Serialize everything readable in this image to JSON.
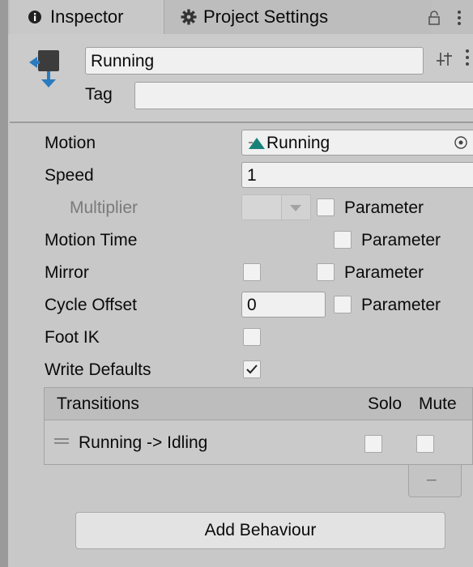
{
  "tabs": [
    {
      "label": "Inspector",
      "icon": "info-icon",
      "active": true
    },
    {
      "label": "Project Settings",
      "icon": "gear-icon",
      "active": false
    }
  ],
  "header": {
    "state_name": "Running",
    "tag_label": "Tag",
    "tag_value": ""
  },
  "properties": {
    "motion_label": "Motion",
    "motion_value": "Running",
    "speed_label": "Speed",
    "speed_value": "1",
    "multiplier_label": "Multiplier",
    "motion_time_label": "Motion Time",
    "mirror_label": "Mirror",
    "cycle_offset_label": "Cycle Offset",
    "cycle_offset_value": "0",
    "foot_ik_label": "Foot IK",
    "write_defaults_label": "Write Defaults",
    "write_defaults_checked": true,
    "parameter_label": "Parameter"
  },
  "transitions": {
    "header": "Transitions",
    "solo_label": "Solo",
    "mute_label": "Mute",
    "items": [
      {
        "label": "Running -> Idling"
      }
    ],
    "remove_label": "–"
  },
  "add_behaviour_label": "Add Behaviour"
}
